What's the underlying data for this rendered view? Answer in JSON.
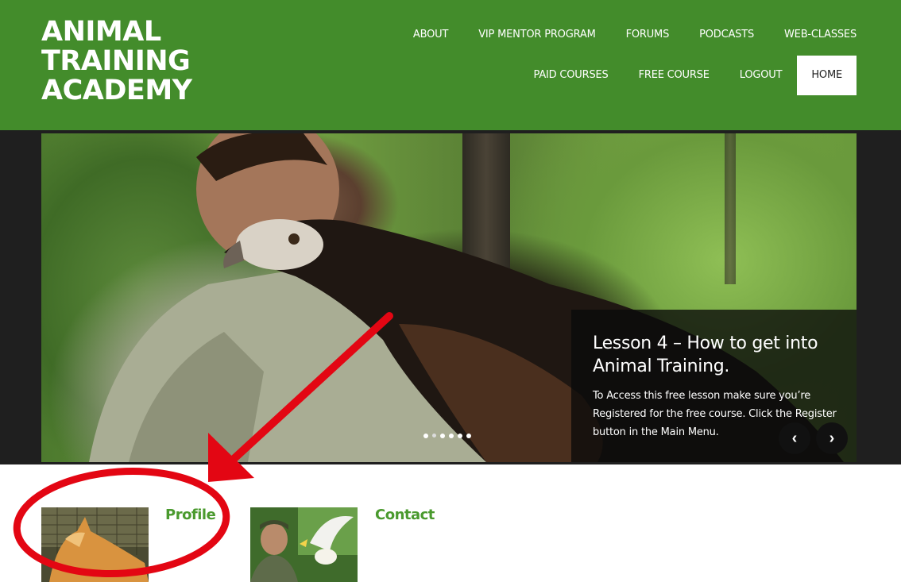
{
  "brand": {
    "logo_lines": [
      "ANIMAL",
      "TRAINING",
      "ACADEMY"
    ],
    "header_color": "#438c2b",
    "accent_green": "#4a9a2e",
    "annotation_red": "#e30613"
  },
  "nav": {
    "row1": [
      "ABOUT",
      "VIP MENTOR PROGRAM",
      "FORUMS",
      "PODCASTS",
      "WEB-CLASSES"
    ],
    "row2": [
      "PAID COURSES",
      "FREE COURSE",
      "LOGOUT"
    ],
    "active": "HOME"
  },
  "slider": {
    "caption_title": "Lesson 4 – How to get into Animal Training.",
    "caption_body": "To Access this free lesson make sure you’re Registered for the free course. Click the Register button in the Main Menu.",
    "prev_icon": "chevron-left-icon",
    "next_icon": "chevron-right-icon",
    "slide_count": 6,
    "active_slide": 1
  },
  "cards": [
    {
      "title": "Profile",
      "image": "dingo-photo"
    },
    {
      "title": "Contact",
      "image": "trainer-with-cockatoo-photo"
    }
  ]
}
